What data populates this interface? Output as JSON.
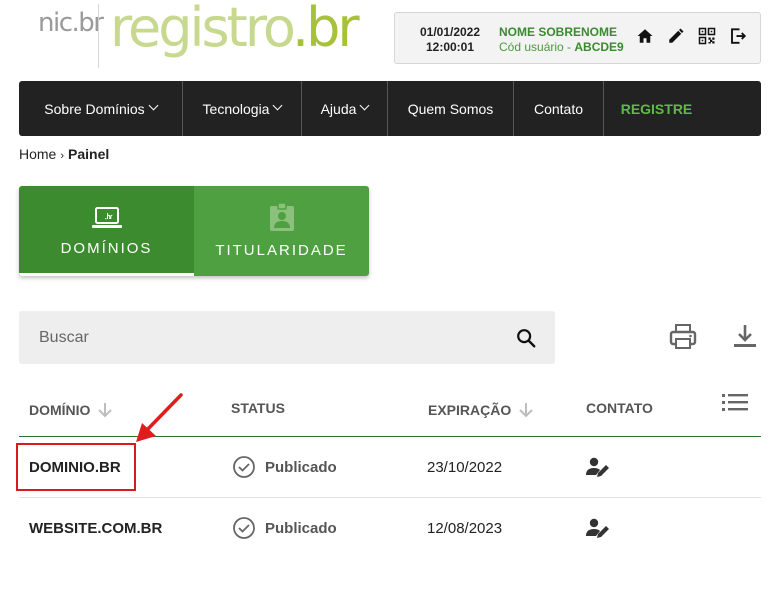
{
  "logo": {
    "nic": "nic",
    "nic_suffix": "br",
    "registro": "registro",
    "registro_suffix": "br"
  },
  "user": {
    "date": "01/01/2022",
    "time": "12:00:01",
    "name": "NOME SOBRENOME",
    "code_label": "Cód usuário - ",
    "code": "ABCDE9"
  },
  "header_icons": [
    "home-icon",
    "edit-icon",
    "qr-code-icon",
    "logout-icon"
  ],
  "nav": [
    {
      "label": "Sobre Domínios",
      "dropdown": true
    },
    {
      "label": "Tecnologia",
      "dropdown": true
    },
    {
      "label": "Ajuda",
      "dropdown": true
    },
    {
      "label": "Quem Somos",
      "dropdown": false
    },
    {
      "label": "Contato",
      "dropdown": false
    },
    {
      "label": "REGISTRE",
      "dropdown": false
    }
  ],
  "breadcrumb": {
    "home": "Home",
    "sep": "›",
    "current": "Painel"
  },
  "tabs": [
    {
      "label": "DOMÍNIOS",
      "icon": "laptop-br-icon",
      "active": true
    },
    {
      "label": "TITULARIDADE",
      "icon": "badge-icon",
      "active": false
    }
  ],
  "search": {
    "placeholder": "Buscar",
    "value": ""
  },
  "table": {
    "headers": {
      "domain": "DOMÍNIO",
      "status": "STATUS",
      "expiration": "EXPIRAÇÃO",
      "contact": "CONTATO"
    },
    "rows": [
      {
        "domain": "DOMINIO.BR",
        "status": "Publicado",
        "expiration": "23/10/2022"
      },
      {
        "domain": "WEBSITE.COM.BR",
        "status": "Publicado",
        "expiration": "12/08/2023"
      }
    ]
  },
  "colors": {
    "green_dark": "#3d8b2f",
    "green_light": "#4fa041",
    "nav_bg": "#222222",
    "annotation": "#d61c1c"
  }
}
